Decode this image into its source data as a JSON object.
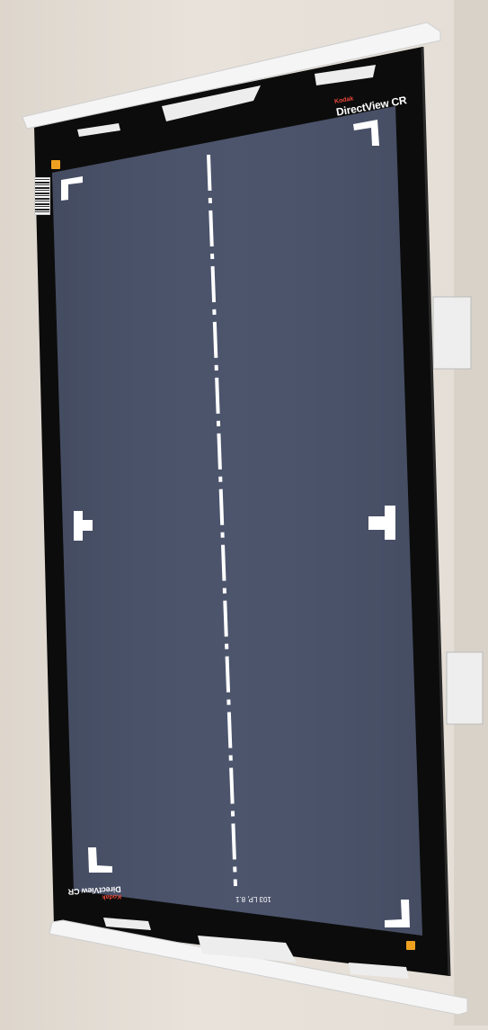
{
  "scene": {
    "description_type": "photo",
    "colors": {
      "wall": "#e6e0d8",
      "frame": "#0d0d0d",
      "panel": "#4a5269",
      "marks": "#ffffff",
      "rail": "#f4f4f4",
      "orange_tag": "#f0a020"
    }
  },
  "labels": {
    "brand_top_kodak": "Kodak",
    "brand_top_name": "DirectView CR",
    "brand_bottom_kodak": "Kodak",
    "brand_bottom_name": "DirectView CR",
    "plate_text": "103 LP, 8.1"
  }
}
